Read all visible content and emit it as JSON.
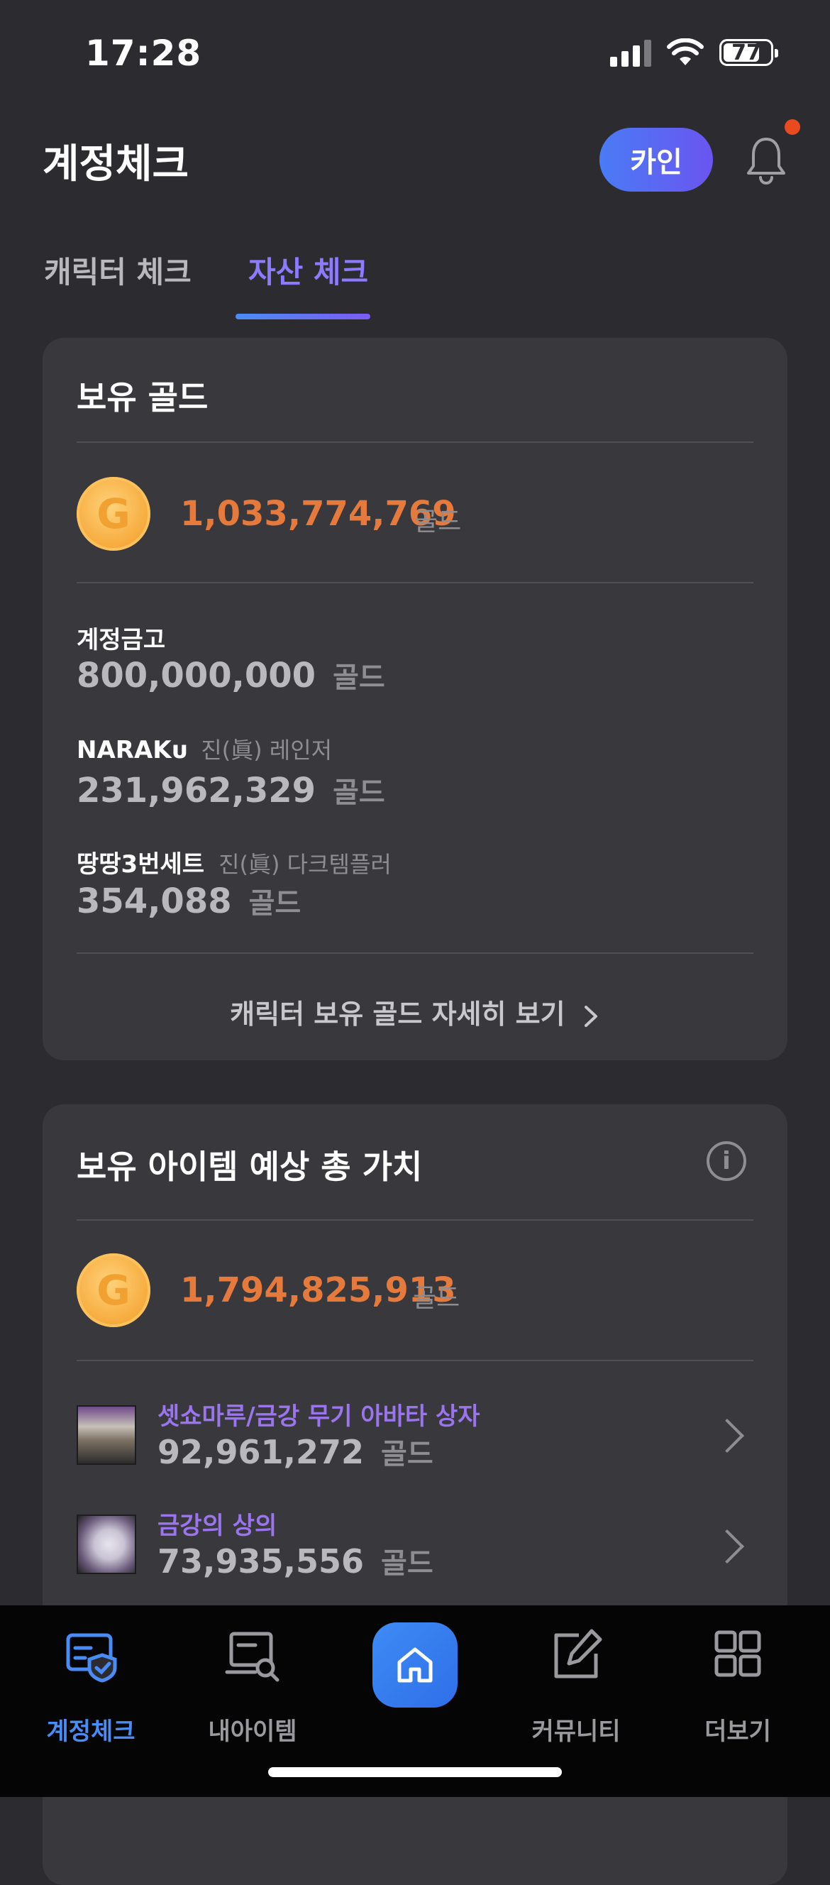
{
  "status_bar": {
    "time": "17:28",
    "battery": "77"
  },
  "header": {
    "title": "계정체크",
    "login_label": "카인"
  },
  "tabs": [
    {
      "label": "캐릭터 체크"
    },
    {
      "label": "자산 체크"
    }
  ],
  "gold_card": {
    "title": "보유 골드",
    "total": "1,033,774,769",
    "unit": "골드",
    "rows": [
      {
        "name": "계정금고",
        "sub": "",
        "value": "800,000,000",
        "unit": "골드"
      },
      {
        "name": "NARAKᴜ",
        "sub": "진(眞) 레인저",
        "value": "231,962,329",
        "unit": "골드"
      },
      {
        "name": "땅땅3번세트",
        "sub": "진(眞) 다크템플러",
        "value": "354,088",
        "unit": "골드"
      }
    ],
    "detail_link": "캐릭터 보유 골드 자세히 보기"
  },
  "item_card": {
    "title": "보유 아이템 예상 총 가치",
    "total": "1,794,825,913",
    "unit": "골드",
    "items": [
      {
        "name": "셋쇼마루/금강 무기 아바타 상자",
        "value": "92,961,272",
        "unit": "골드"
      },
      {
        "name": "금강의 상의",
        "value": "73,935,556",
        "unit": "골드"
      }
    ]
  },
  "bottom_nav": [
    {
      "label": "계정체크"
    },
    {
      "label": "내아이템"
    },
    {
      "label": "커뮤니티"
    },
    {
      "label": "더보기"
    }
  ],
  "colors": {
    "background": "#2c2c30",
    "card": "#38383d",
    "accent_blue": "#4a8cf5",
    "accent_purple": "#8d7bff",
    "gold_orange": "#e57a3c"
  }
}
